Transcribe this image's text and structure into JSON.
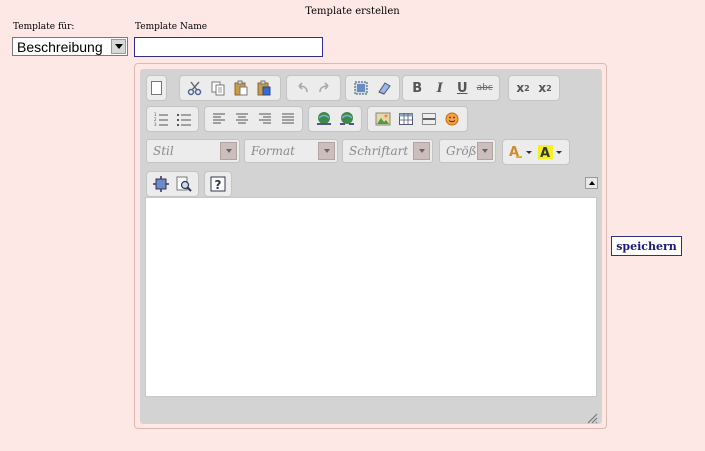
{
  "page": {
    "title": "Template erstellen"
  },
  "form": {
    "template_for_label": "Template für:",
    "template_name_label": "Template Name",
    "template_for_value": "Beschreibung",
    "template_name_value": ""
  },
  "toolbar": {
    "styles": "Stil",
    "format": "Format",
    "font": "Schriftart",
    "size": "Größ",
    "superscript_label": "2",
    "subscript_label": "2"
  },
  "actions": {
    "save": "speichern"
  },
  "icons": [
    "new-page-icon",
    "cut-icon",
    "copy-icon",
    "paste-icon",
    "paste-word-icon",
    "undo-icon",
    "redo-icon",
    "select-all-icon",
    "remove-format-icon",
    "bold-icon",
    "italic-icon",
    "underline-icon",
    "strike-icon",
    "subscript-icon",
    "superscript-icon",
    "numbered-list-icon",
    "bulleted-list-icon",
    "align-left-icon",
    "align-center-icon",
    "align-right-icon",
    "justify-icon",
    "link-icon",
    "unlink-icon",
    "image-icon",
    "table-icon",
    "horizontal-rule-icon",
    "smiley-icon",
    "text-color-icon",
    "bg-color-icon",
    "maximize-icon",
    "preview-icon",
    "about-icon"
  ]
}
